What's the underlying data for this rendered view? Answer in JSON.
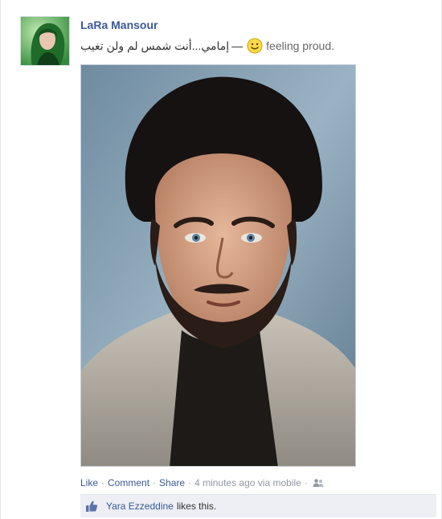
{
  "post": {
    "author": "LaRa Mansour",
    "status_arabic": "إمامي...أنت شمس لم ولن تغيب",
    "status_dash": "—",
    "feeling": "feeling proud.",
    "smiley_icon": "smiley-face-icon"
  },
  "actions": {
    "like": "Like",
    "comment": "Comment",
    "share": "Share",
    "separator": "·",
    "time": "4 minutes ago via mobile",
    "audience_icon": "friends-icon"
  },
  "likes": {
    "icon": "thumbs-up-icon",
    "liker": "Yara Ezzeddine",
    "suffix": "likes this."
  },
  "colors": {
    "link": "#3b5998",
    "meta": "#9197a3",
    "likes_bg": "#edeff4"
  }
}
